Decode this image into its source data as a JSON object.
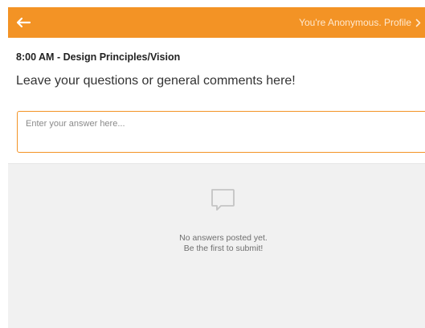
{
  "header": {
    "back_icon": "arrow-left-icon",
    "profile_label": "You're Anonymous. Profile",
    "profile_icon": "chevron-right-icon"
  },
  "session": {
    "title": "8:00 AM - Design Principles/Vision"
  },
  "question": {
    "text": "Leave your questions or general comments here!"
  },
  "answer": {
    "value": "",
    "placeholder": "Enter your answer here..."
  },
  "answers": {
    "empty_icon": "speech-bubble-icon",
    "empty_line1": "No answers posted yet.",
    "empty_line2": "Be the first to submit!"
  },
  "colors": {
    "accent": "#f39325",
    "panel_bg": "#f1f1f1"
  }
}
